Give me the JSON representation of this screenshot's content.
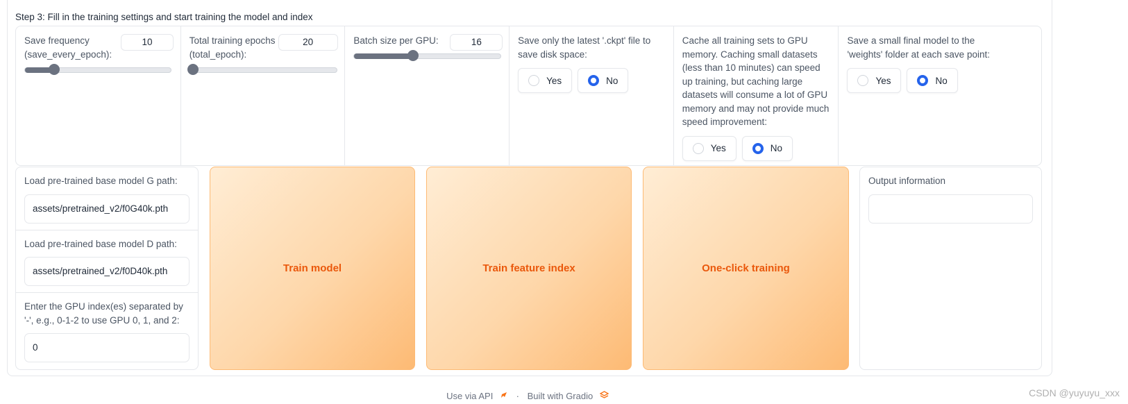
{
  "step_title": "Step 3: Fill in the training settings and start training the model and index",
  "settings": {
    "save_frequency": {
      "label": "Save frequency (save_every_epoch):",
      "value": "10",
      "slider_fraction": 0.2
    },
    "total_epochs": {
      "label": "Total training epochs (total_epoch):",
      "value": "20",
      "slider_fraction": 0.02
    },
    "batch_size": {
      "label": "Batch size per GPU:",
      "value": "16",
      "slider_fraction": 0.4
    },
    "save_latest_ckpt": {
      "label": "Save only the latest '.ckpt' file to save disk space:",
      "options": [
        "Yes",
        "No"
      ],
      "selected": "No"
    },
    "cache_gpu": {
      "label": "Cache all training sets to GPU memory. Caching small datasets (less than 10 minutes) can speed up training, but caching large datasets will consume a lot of GPU memory and may not provide much speed improvement:",
      "options": [
        "Yes",
        "No"
      ],
      "selected": "No"
    },
    "save_small_model": {
      "label": "Save a small final model to the 'weights' folder at each save point:",
      "options": [
        "Yes",
        "No"
      ],
      "selected": "No"
    }
  },
  "paths": {
    "g_label": "Load pre-trained base model G path:",
    "g_value": "assets/pretrained_v2/f0G40k.pth",
    "d_label": "Load pre-trained base model D path:",
    "d_value": "assets/pretrained_v2/f0D40k.pth",
    "gpu_label": "Enter the GPU index(es) separated by '-', e.g., 0-1-2 to use GPU 0, 1, and 2:",
    "gpu_value": "0"
  },
  "buttons": {
    "train_model": "Train model",
    "train_index": "Train feature index",
    "one_click": "One-click training"
  },
  "output": {
    "label": "Output information",
    "value": ""
  },
  "footer": {
    "api": "Use via API",
    "separator": "·",
    "built": "Built with Gradio"
  },
  "watermark": "CSDN @yuyuyu_xxx",
  "colors": {
    "accent_orange": "#ea580c",
    "radio_blue": "#2563eb",
    "button_gradient_end": "#fdba74"
  }
}
